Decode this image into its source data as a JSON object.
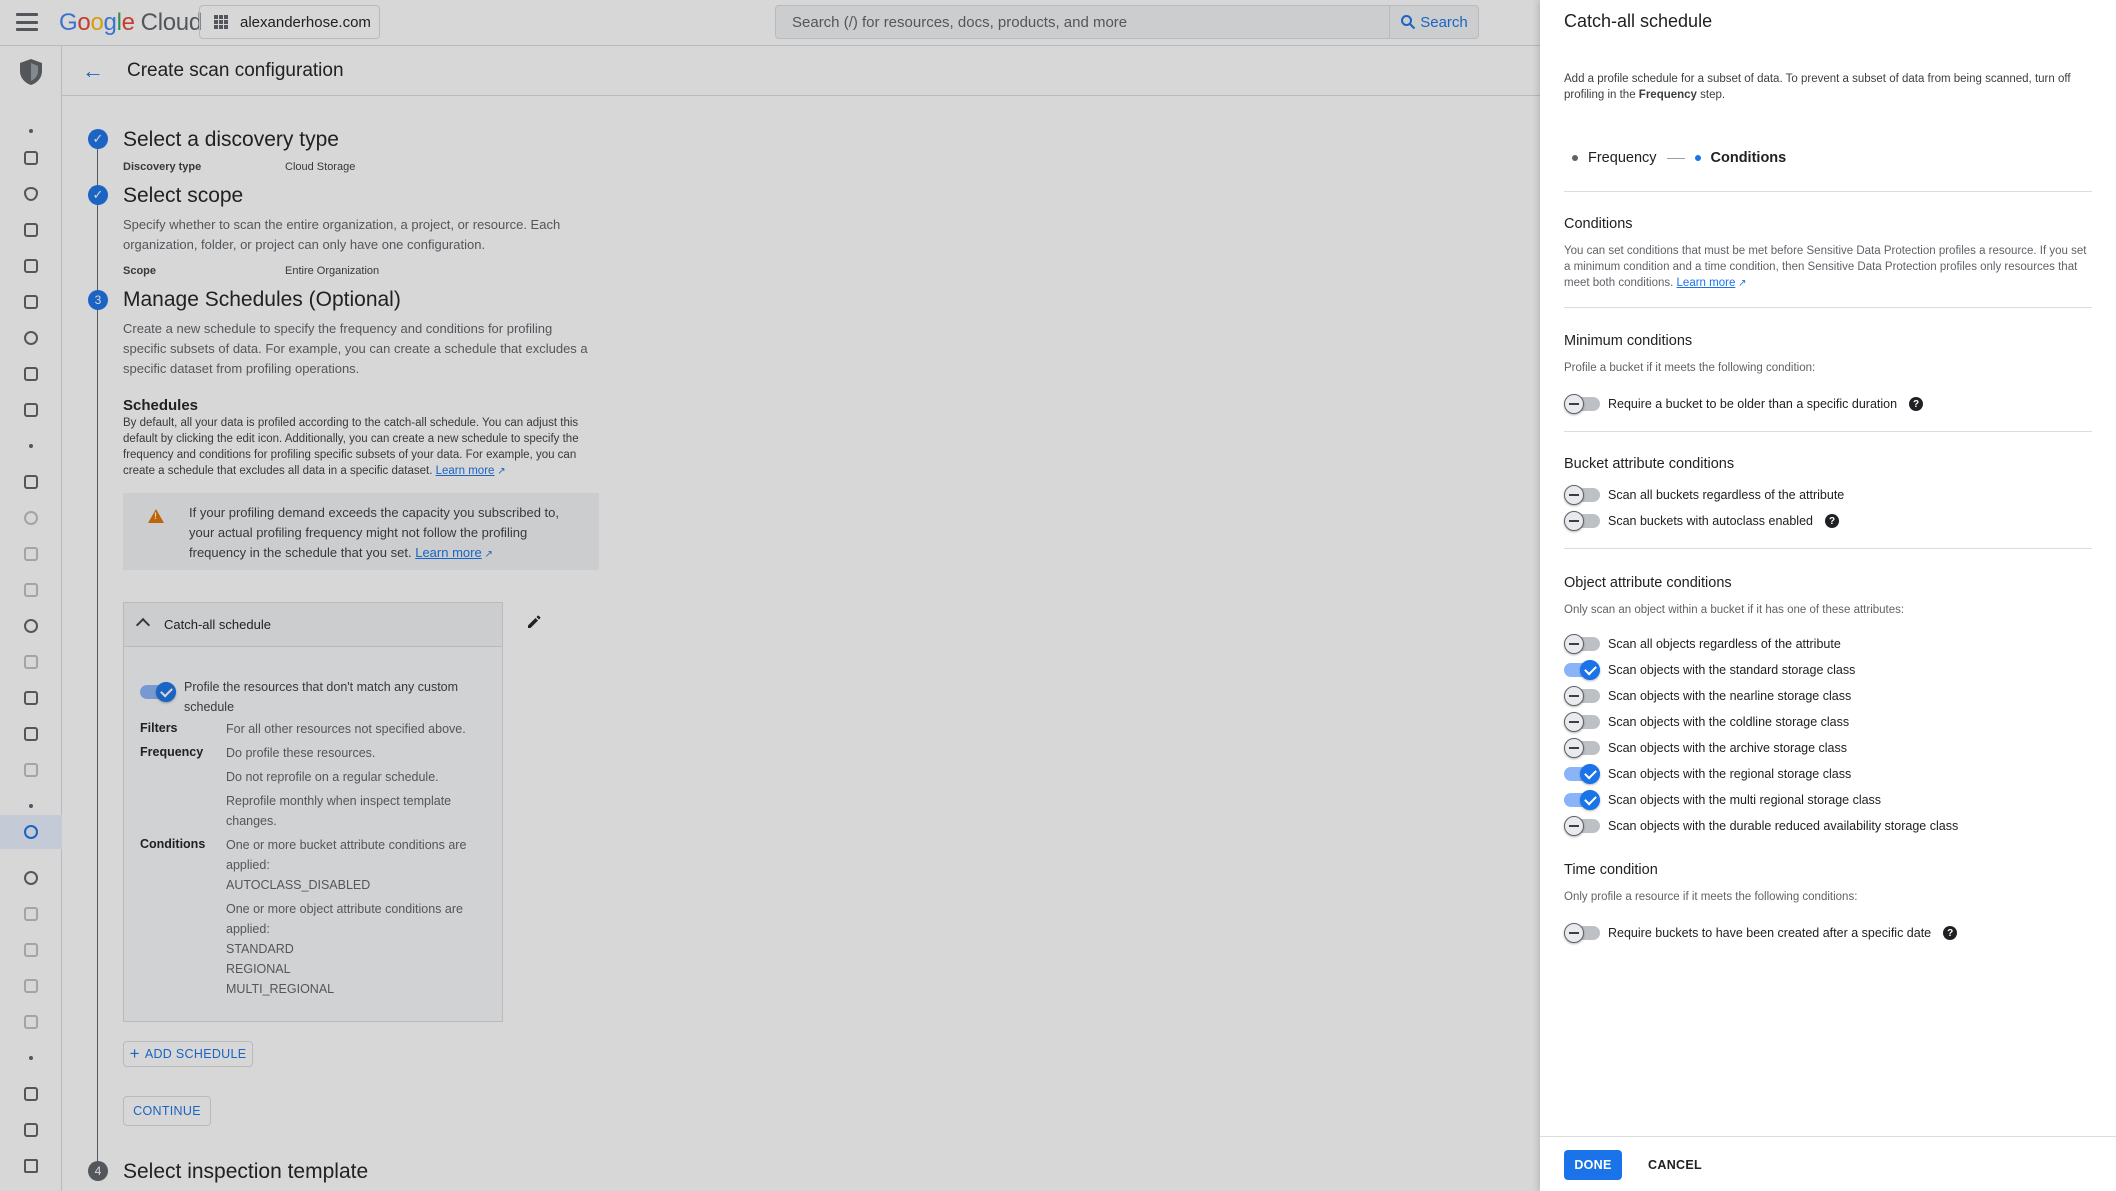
{
  "topbar": {
    "logo_letters": [
      "G",
      "o",
      "o",
      "g",
      "l",
      "e"
    ],
    "logo_suffix": "Cloud",
    "project": "alexanderhose.com",
    "search_placeholder": "Search (/) for resources, docs, products, and more",
    "search_button": "Search"
  },
  "header": {
    "title": "Create scan configuration"
  },
  "steps": {
    "step1": {
      "title": "Select a discovery type",
      "label": "Discovery type",
      "value": "Cloud Storage"
    },
    "step2": {
      "title": "Select scope",
      "description": "Specify whether to scan the entire organization, a project, or resource. Each organization, folder, or project can only have one configuration.",
      "label": "Scope",
      "value": "Entire Organization"
    },
    "step3": {
      "number": "3",
      "title": "Manage Schedules (Optional)",
      "description": "Create a new schedule to specify the frequency and conditions for profiling specific subsets of data. For example, you can create a schedule that excludes a specific dataset from profiling operations.",
      "schedules_heading": "Schedules",
      "schedules_text": "By default, all your data is profiled according to the catch-all schedule. You can adjust this default by clicking the edit icon. Additionally, you can create a new schedule to specify the frequency and conditions for profiling specific subsets of your data. For example, you can create a schedule that excludes all data in a specific dataset.",
      "learn_more": "Learn more",
      "warning_text": "If your profiling demand exceeds the capacity you subscribed to, your actual profiling frequency might not follow the profiling frequency in the schedule that you set.",
      "warning_link": "Learn more",
      "card": {
        "title": "Catch-all schedule",
        "toggle_label": "Profile the resources that don't match any custom schedule",
        "filters_label": "Filters",
        "filters_value": "For all other resources not specified above.",
        "frequency_label": "Frequency",
        "frequency_values": [
          "Do profile these resources.",
          "Do not reprofile on a regular schedule.",
          "Reprofile monthly when inspect template changes."
        ],
        "conditions_label": "Conditions",
        "bucket_cond": "One or more bucket attribute conditions are applied:",
        "bucket_value": "AUTOCLASS_DISABLED",
        "object_cond": "One or more object attribute conditions are applied:",
        "object_values": [
          "STANDARD",
          "REGIONAL",
          "MULTI_REGIONAL"
        ]
      },
      "add_schedule": "ADD SCHEDULE",
      "continue": "CONTINUE"
    },
    "step4": {
      "number": "4",
      "title": "Select inspection template"
    }
  },
  "panel": {
    "title": "Catch-all schedule",
    "desc_prefix": "Add a profile schedule for a subset of data. To prevent a subset of data from being scanned, turn off profiling in the ",
    "desc_bold": "Frequency",
    "desc_suffix": " step.",
    "stepper": {
      "step1": "Frequency",
      "step2": "Conditions"
    },
    "conditions": {
      "heading": "Conditions",
      "text": "You can set conditions that must be met before Sensitive Data Protection profiles a resource. If you set a minimum condition and a time condition, then Sensitive Data Protection profiles only resources that meet both conditions.",
      "link": "Learn more"
    },
    "minimum": {
      "heading": "Minimum conditions",
      "text": "Profile a bucket if it meets the following condition:",
      "option": "Require a bucket to be older than a specific duration"
    },
    "bucket": {
      "heading": "Bucket attribute conditions",
      "options": [
        "Scan all buckets regardless of the attribute",
        "Scan buckets with autoclass enabled"
      ]
    },
    "object": {
      "heading": "Object attribute conditions",
      "text": "Only scan an object within a bucket if it has one of these attributes:",
      "options": [
        "Scan all objects regardless of the attribute",
        "Scan objects with the standard storage class",
        "Scan objects with the nearline storage class",
        "Scan objects with the coldline storage class",
        "Scan objects with the archive storage class",
        "Scan objects with the regional storage class",
        "Scan objects with the multi regional storage class",
        "Scan objects with the durable reduced availability storage class"
      ],
      "states": [
        false,
        true,
        false,
        false,
        false,
        true,
        true,
        false
      ]
    },
    "time": {
      "heading": "Time condition",
      "text": "Only profile a resource if it meets the following conditions:",
      "option": "Require buckets to have been created after a specific date"
    },
    "help_glyph": "?",
    "done": "DONE",
    "cancel": "CANCEL"
  }
}
